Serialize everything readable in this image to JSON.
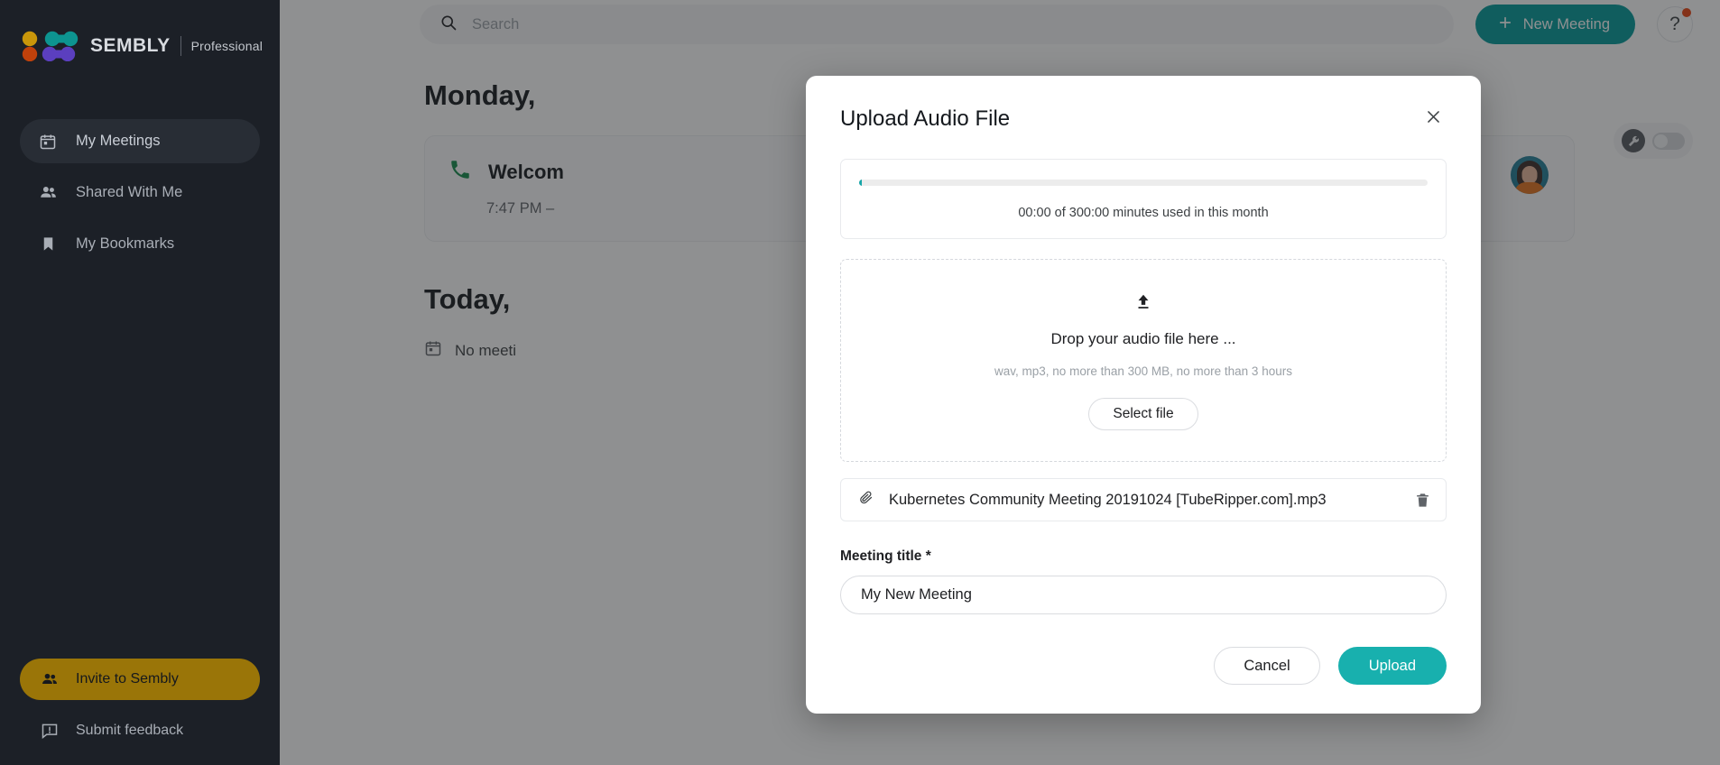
{
  "sidebar": {
    "brand": {
      "name": "SEMBLY",
      "plan": "Professional"
    },
    "items": [
      {
        "label": "My Meetings",
        "icon": "calendar-icon",
        "active": true
      },
      {
        "label": "Shared With Me",
        "icon": "people-icon",
        "active": false
      },
      {
        "label": "My Bookmarks",
        "icon": "bookmark-icon",
        "active": false
      }
    ],
    "invite_label": "Invite to Sembly",
    "feedback_label": "Submit feedback"
  },
  "topbar": {
    "search_placeholder": "Search",
    "new_meeting_label": "New Meeting",
    "help_label": "?"
  },
  "main": {
    "day_heading_1": "Monday,",
    "meeting_title": "Welcom",
    "meeting_time": "7:47 PM –",
    "day_heading_2": "Today,",
    "no_meetings": "No meeti"
  },
  "modal": {
    "title": "Upload Audio File",
    "close_label": "✕",
    "usage_text": "00:00 of 300:00 minutes used in this month",
    "usage_percent": 0,
    "dropzone": {
      "title": "Drop your audio file here ...",
      "hint": "wav, mp3, no more than 300 MB, no more than 3 hours",
      "select_file_label": "Select file"
    },
    "file": {
      "name": "Kubernetes Community Meeting 20191024 [TubeRipper.com].mp3"
    },
    "meeting_title_label": "Meeting title *",
    "meeting_title_value": "My New Meeting",
    "meeting_title_placeholder": "My New Meeting",
    "cancel_label": "Cancel",
    "upload_label": "Upload"
  },
  "colors": {
    "accent_teal": "#18b0ae",
    "brand_teal": "#009999",
    "invite_gold": "#9a7508",
    "sidebar_bg": "#1c2027",
    "notification_red": "#e8420f"
  }
}
